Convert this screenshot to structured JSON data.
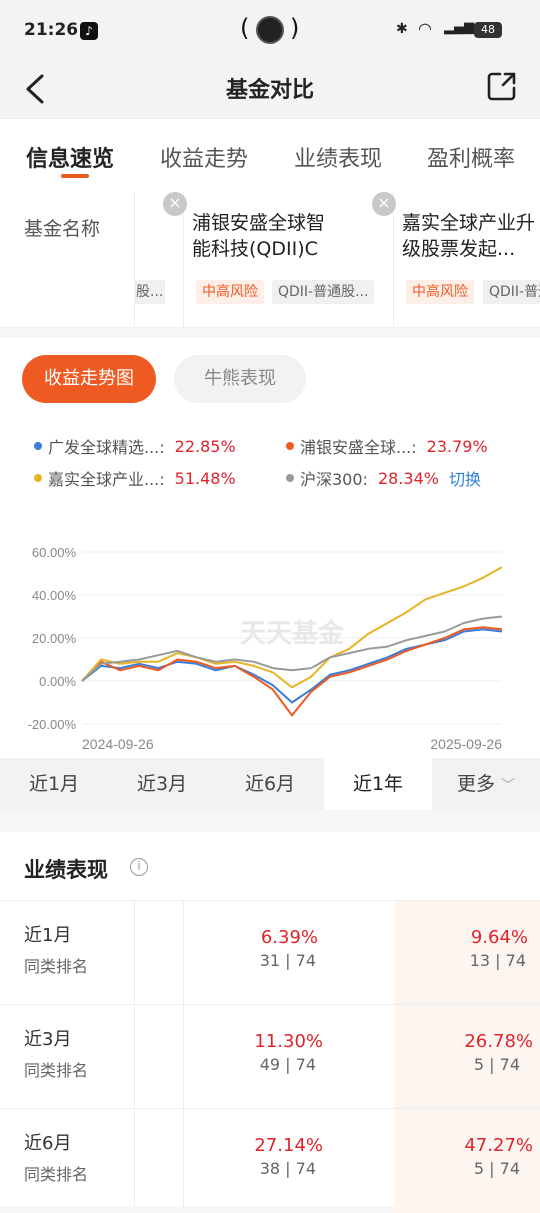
{
  "status": {
    "time": "21:26",
    "battery": "48"
  },
  "nav": {
    "title": "基金对比"
  },
  "tabs": [
    "信息速览",
    "收益走势",
    "业绩表现",
    "盈利概率"
  ],
  "fund_row": {
    "label": "基金名称",
    "partial_badge": "股...",
    "funds": [
      {
        "name_line1": "浦银安盛全球智",
        "name_line2": "能科技(QDII)C",
        "risk": "中高风险",
        "type": "QDII-普通股..."
      },
      {
        "name_line1": "嘉实全球产业升",
        "name_line2": "级股票发起...",
        "risk": "中高风险",
        "type": "QDII-普通"
      }
    ]
  },
  "chart_section": {
    "btn_active": "收益走势图",
    "btn_inactive": "牛熊表现",
    "legend": [
      {
        "name": "广发全球精选...:",
        "value": "22.85%",
        "color": "#3b7dd8"
      },
      {
        "name": "浦银安盛全球...:",
        "value": "23.79%",
        "color": "#ef5a22"
      },
      {
        "name": "嘉实全球产业...:",
        "value": "51.48%",
        "color": "#e6b322"
      },
      {
        "name": "沪深300:",
        "value": "28.34%",
        "color": "#9a9a9a"
      }
    ],
    "switch_label": "切换",
    "watermark": "天天基金"
  },
  "chart_data": {
    "type": "line",
    "x_start": "2024-09-26",
    "x_end": "2025-09-26",
    "y_ticks": [
      "60.00%",
      "40.00%",
      "20.00%",
      "0.00%",
      "-20.00%"
    ],
    "ylim": [
      -20,
      60
    ],
    "grid": true,
    "series": [
      {
        "name": "广发全球精选",
        "color": "#3b7dd8",
        "values": [
          0,
          7,
          6,
          8,
          6,
          9,
          8,
          5,
          7,
          3,
          -2,
          -10,
          -4,
          3,
          5,
          8,
          11,
          15,
          17,
          19,
          23,
          24,
          23
        ]
      },
      {
        "name": "浦银安盛全球",
        "color": "#ef5a22",
        "values": [
          0,
          9,
          5,
          7,
          5,
          10,
          9,
          6,
          7,
          2,
          -4,
          -16,
          -5,
          2,
          4,
          7,
          10,
          14,
          17,
          20,
          24,
          25,
          24
        ]
      },
      {
        "name": "嘉实全球产业",
        "color": "#e6b322",
        "values": [
          0,
          10,
          8,
          9,
          9,
          13,
          11,
          8,
          9,
          7,
          4,
          -3,
          2,
          11,
          15,
          22,
          27,
          32,
          38,
          41,
          44,
          48,
          53
        ]
      },
      {
        "name": "沪深300",
        "color": "#9a9a9a",
        "values": [
          0,
          8,
          9,
          10,
          12,
          14,
          11,
          9,
          10,
          9,
          6,
          5,
          6,
          11,
          13,
          15,
          16,
          19,
          21,
          23,
          27,
          29,
          30
        ]
      }
    ]
  },
  "periods": [
    "近1月",
    "近3月",
    "近6月",
    "近1年",
    "更多"
  ],
  "active_period": "近1年",
  "performance": {
    "title": "业绩表现",
    "rows": [
      {
        "label": "近1月",
        "sub": "同类排名",
        "v1": "6.39%",
        "r1": "31 | 74",
        "v2": "9.64%",
        "r2": "13 | 74"
      },
      {
        "label": "近3月",
        "sub": "同类排名",
        "v1": "11.30%",
        "r1": "49 | 74",
        "v2": "26.78%",
        "r2": "5 | 74"
      },
      {
        "label": "近6月",
        "sub": "同类排名",
        "v1": "27.14%",
        "r1": "38 | 74",
        "v2": "47.27%",
        "r2": "5 | 74"
      }
    ]
  }
}
